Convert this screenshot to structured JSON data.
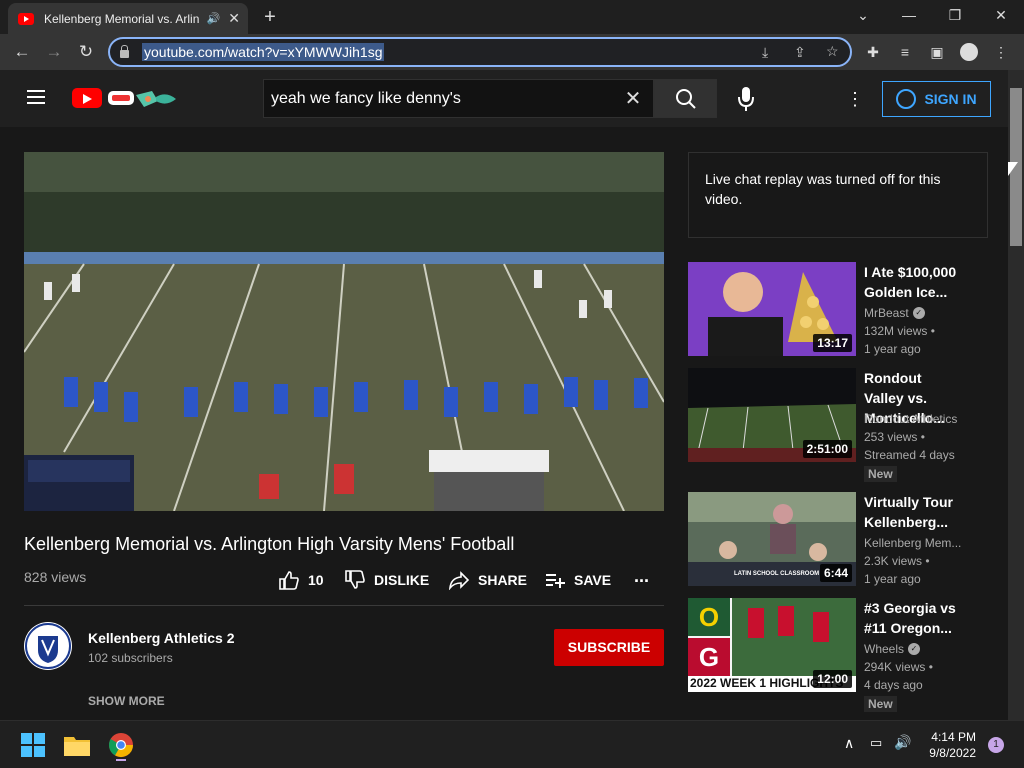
{
  "browser": {
    "tab_title": "Kellenberg Memorial vs. Arlin",
    "url": "youtube.com/watch?v=xYMWWJih1sg"
  },
  "youtube": {
    "search_query": "yeah we fancy like denny's",
    "sign_in_label": "SIGN IN"
  },
  "video": {
    "title": "Kellenberg Memorial vs. Arlington High Varsity Mens' Football",
    "views": "828 views",
    "likes": "10",
    "dislike_label": "DISLIKE",
    "share_label": "SHARE",
    "save_label": "SAVE",
    "more_label": "..."
  },
  "channel": {
    "name": "Kellenberg Athletics 2",
    "subscribers": "102 subscribers",
    "subscribe_label": "SUBSCRIBE",
    "show_more_label": "SHOW MORE"
  },
  "chat": {
    "message": "Live chat replay was turned off for this video."
  },
  "recommendations": [
    {
      "title": "I Ate $100,000 Golden Ice...",
      "channel": "MrBeast",
      "verified": true,
      "views": "132M views •",
      "age": "1 year ago",
      "duration": "13:17",
      "badge": ""
    },
    {
      "title": "Rondout Valley vs. Monticello...",
      "channel": "Rondout Athletics",
      "verified": false,
      "views": "253 views •",
      "age": "Streamed 4 days",
      "duration": "2:51:00",
      "badge": "New"
    },
    {
      "title": "Virtually Tour Kellenberg...",
      "channel": "Kellenberg Mem...",
      "verified": false,
      "views": "2.3K views •",
      "age": "1 year ago",
      "duration": "6:44",
      "badge": ""
    },
    {
      "title": "#3 Georgia vs #11 Oregon...",
      "channel": "Wheels",
      "verified": true,
      "views": "294K views •",
      "age": "4 days ago",
      "duration": "12:00",
      "badge": "New"
    }
  ],
  "thumb_text": {
    "latin_school": "LATIN SCHOOL CLASSROOM",
    "week1": "2022 WEEK 1 HIGHLIGHTS"
  },
  "taskbar": {
    "time": "4:14 PM",
    "date": "9/8/2022",
    "notifications": "1"
  },
  "colors": {
    "accent_blue": "#3ea6ff",
    "subscribe_red": "#cc0000",
    "youtube_red": "#ff0000"
  }
}
